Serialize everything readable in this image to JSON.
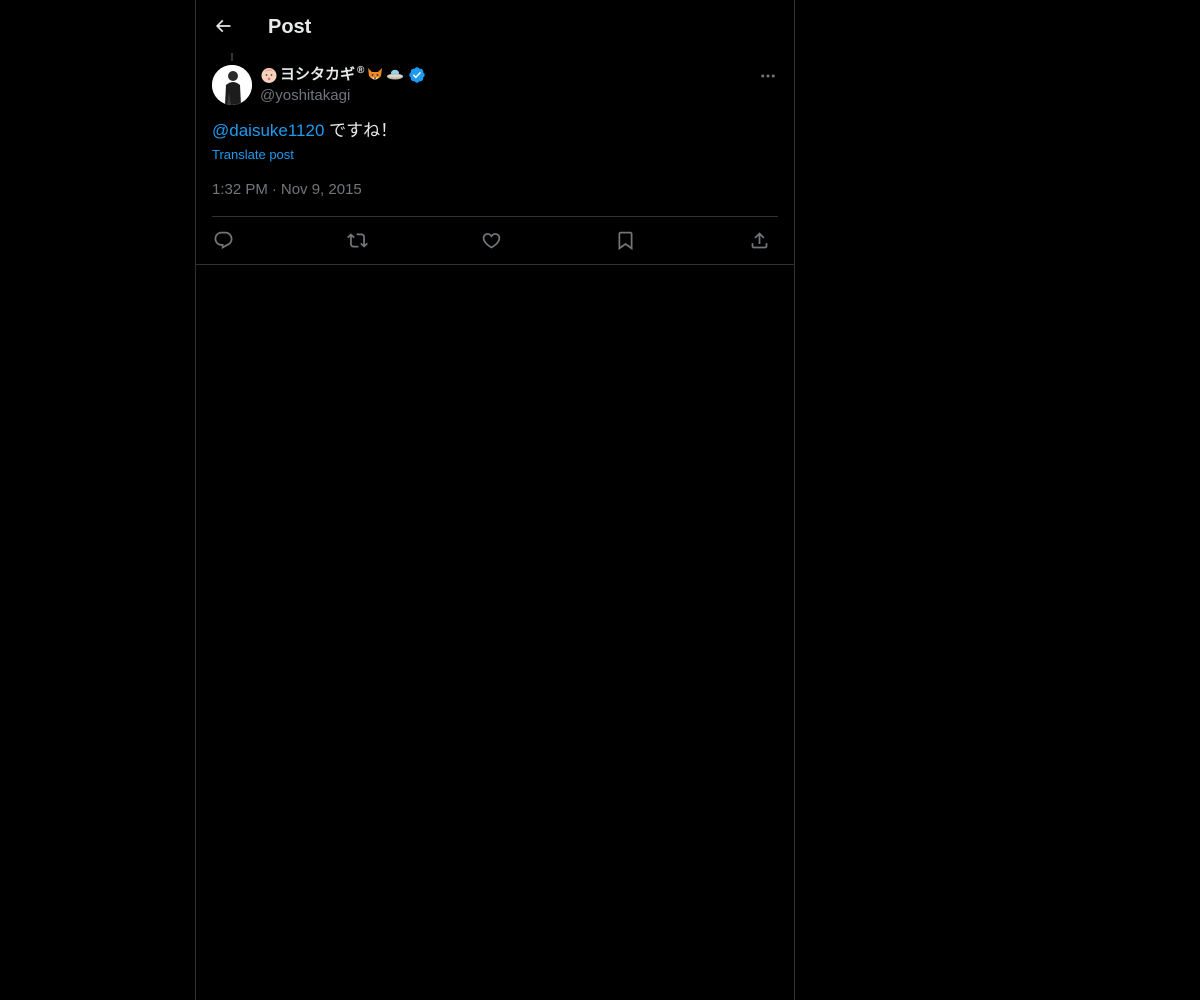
{
  "header": {
    "title": "Post",
    "back_icon": "arrow-left-icon"
  },
  "post": {
    "author": {
      "display_name": "ヨシタカギ",
      "registered_mark": "®",
      "handle": "@yoshitakagi",
      "verified": true,
      "emojis": [
        "baby-face-icon",
        "fox-face-icon",
        "ufo-icon"
      ]
    },
    "mention": "@daisuke1120",
    "text": " ですね！",
    "translate_label": "Translate post",
    "time": "1:32 PM",
    "separator": "·",
    "date": "Nov 9, 2015"
  },
  "actions": [
    "reply-icon",
    "repost-icon",
    "like-icon",
    "bookmark-icon",
    "share-icon"
  ],
  "colors": {
    "background": "#000000",
    "text": "#e7e9ea",
    "secondary_text": "#71767b",
    "accent": "#1d9bf0",
    "border": "#2f3336"
  }
}
